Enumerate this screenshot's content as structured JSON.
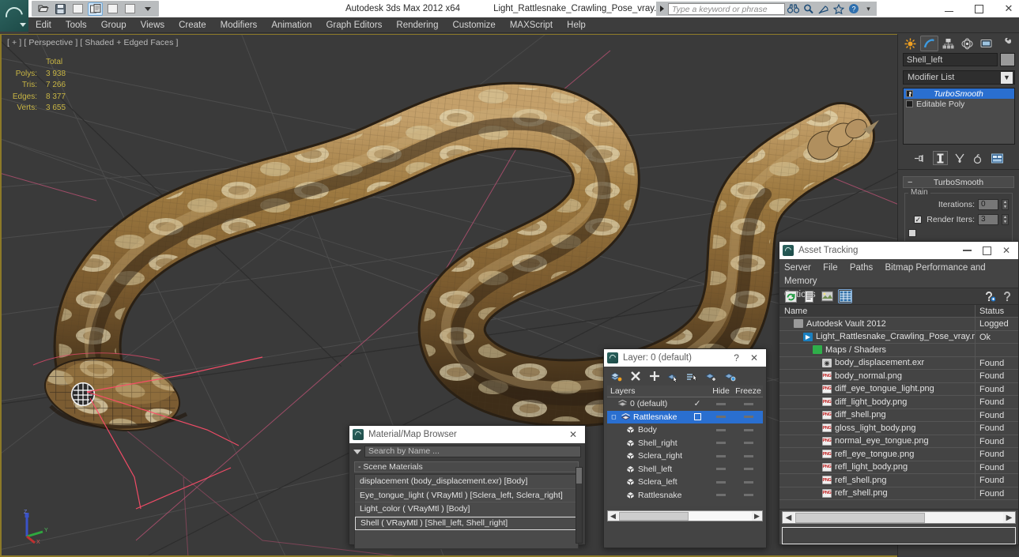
{
  "titlebar": {
    "app_title": "Autodesk 3ds Max  2012 x64",
    "file_title": "Light_Rattlesnake_Crawling_Pose_vray.max",
    "quick_access": [
      {
        "name": "open-file",
        "label": "open"
      },
      {
        "name": "save-file",
        "label": "save"
      },
      {
        "name": "undo",
        "label": "undo"
      },
      {
        "name": "redo",
        "label": "redo"
      },
      {
        "name": "blank-1",
        "label": ""
      },
      {
        "name": "blank-2",
        "label": ""
      }
    ],
    "search_placeholder": "Type a keyword or phrase",
    "help_icons": [
      "binoculars-icon",
      "magnifier-icon",
      "satellite-icon",
      "star-icon",
      "help-icon"
    ],
    "window_controls": [
      "minimize",
      "maximize",
      "close"
    ]
  },
  "menu": {
    "items": [
      "Edit",
      "Tools",
      "Group",
      "Views",
      "Create",
      "Modifiers",
      "Animation",
      "Graph Editors",
      "Rendering",
      "Customize",
      "MAXScript",
      "Help"
    ]
  },
  "viewport": {
    "label": "[ + ] [ Perspective ] [ Shaded + Edged Faces ]",
    "stats": {
      "header": "Total",
      "rows": [
        {
          "label": "Polys:",
          "value": "3 938"
        },
        {
          "label": "Tris:",
          "value": "7 266"
        },
        {
          "label": "Edges:",
          "value": "8 377"
        },
        {
          "label": "Verts:",
          "value": "3 655"
        }
      ]
    },
    "axis": {
      "x": "X",
      "y": "Y",
      "z": "Z"
    },
    "colors": {
      "background": "#3a3a3a",
      "grid": "#565656",
      "border": "#8d7a28",
      "stats_text": "#c8b544",
      "snake_body": "#8a6a3a",
      "snake_light": "#e0d5b0",
      "snake_dark": "#4a3420",
      "selection": "#ff4d6a"
    }
  },
  "command_panel": {
    "tabs": [
      "create-tab",
      "modify-tab",
      "hierarchy-tab",
      "motion-tab",
      "display-tab",
      "utilities-tab"
    ],
    "selected_tab": "modify-tab",
    "object_name": "Shell_left",
    "modifier_list_label": "Modifier List",
    "stack": [
      {
        "label": "TurboSmooth",
        "selected": true
      },
      {
        "label": "Editable Poly",
        "selected": false
      }
    ],
    "stack_buttons": [
      "pin-stack-icon",
      "show-end-result-icon",
      "make-unique-icon",
      "remove-modifier-icon",
      "configure-sets-icon"
    ],
    "rollout": {
      "title": "TurboSmooth",
      "group_label": "Main",
      "params": [
        {
          "label": "Iterations:",
          "value": "0",
          "checkbox": false
        },
        {
          "label": "Render Iters:",
          "value": "3",
          "checkbox": true
        }
      ]
    }
  },
  "asset_tracking": {
    "title": "Asset Tracking",
    "menu": [
      "Server",
      "File",
      "Paths",
      "Bitmap Performance and Memory",
      "Options"
    ],
    "toolbar_icons": [
      "refresh-icon",
      "list-view-icon",
      "thumbnail-view-icon",
      "grid-view-icon",
      "add-help-icon",
      "help-icon"
    ],
    "columns": {
      "name": "Name",
      "status": "Status"
    },
    "rows": [
      {
        "name": "Autodesk Vault 2012",
        "status": "Logged",
        "indent": 0,
        "icon": "vault-icon"
      },
      {
        "name": "Light_Rattlesnake_Crawling_Pose_vray.max",
        "status": "Ok",
        "indent": 1,
        "icon": "max-file-icon"
      },
      {
        "name": "Maps / Shaders",
        "status": "",
        "indent": 2,
        "icon": "maps-icon"
      },
      {
        "name": "body_displacement.exr",
        "status": "Found",
        "indent": 3,
        "icon": "exr-icon"
      },
      {
        "name": "body_normal.png",
        "status": "Found",
        "indent": 3,
        "icon": "png-icon"
      },
      {
        "name": "diff_eye_tongue_light.png",
        "status": "Found",
        "indent": 3,
        "icon": "png-icon"
      },
      {
        "name": "diff_light_body.png",
        "status": "Found",
        "indent": 3,
        "icon": "png-icon"
      },
      {
        "name": "diff_shell.png",
        "status": "Found",
        "indent": 3,
        "icon": "png-icon"
      },
      {
        "name": "gloss_light_body.png",
        "status": "Found",
        "indent": 3,
        "icon": "png-icon"
      },
      {
        "name": "normal_eye_tongue.png",
        "status": "Found",
        "indent": 3,
        "icon": "png-icon"
      },
      {
        "name": "refl_eye_tongue.png",
        "status": "Found",
        "indent": 3,
        "icon": "png-icon"
      },
      {
        "name": "refl_light_body.png",
        "status": "Found",
        "indent": 3,
        "icon": "png-icon"
      },
      {
        "name": "refl_shell.png",
        "status": "Found",
        "indent": 3,
        "icon": "png-icon"
      },
      {
        "name": "refr_shell.png",
        "status": "Found",
        "indent": 3,
        "icon": "png-icon"
      }
    ]
  },
  "layer_dialog": {
    "title": "Layer: 0 (default)",
    "help_label": "?",
    "close_label": "✕",
    "toolbar_icons": [
      "create-new-layer-icon",
      "delete-layer-icon",
      "add-selection-icon",
      "select-objects-icon",
      "select-highlighted-icon",
      "highlight-selected-icon",
      "hide-unselected-icon"
    ],
    "columns": {
      "layers": "Layers",
      "hide": "Hide",
      "freeze": "Freeze"
    },
    "rows": [
      {
        "name": "0 (default)",
        "indent": 0,
        "selected": false,
        "mark": "check",
        "icon": "layer-icon"
      },
      {
        "name": "Rattlesnake",
        "indent": 0,
        "selected": true,
        "mark": "box",
        "icon": "layer-icon"
      },
      {
        "name": "Body",
        "indent": 1,
        "selected": false,
        "mark": "",
        "icon": "object-icon"
      },
      {
        "name": "Shell_right",
        "indent": 1,
        "selected": false,
        "mark": "",
        "icon": "object-icon"
      },
      {
        "name": "Sclera_right",
        "indent": 1,
        "selected": false,
        "mark": "",
        "icon": "object-icon"
      },
      {
        "name": "Shell_left",
        "indent": 1,
        "selected": false,
        "mark": "",
        "icon": "object-icon"
      },
      {
        "name": "Sclera_left",
        "indent": 1,
        "selected": false,
        "mark": "",
        "icon": "object-icon"
      },
      {
        "name": "Rattlesnake",
        "indent": 1,
        "selected": false,
        "mark": "",
        "icon": "object-icon"
      }
    ]
  },
  "material_browser": {
    "title": "Material/Map Browser",
    "close_label": "✕",
    "search_placeholder": "Search by Name ...",
    "group_label": "- Scene Materials",
    "items": [
      {
        "label": "displacement (body_displacement.exr) [Body]",
        "selected": false
      },
      {
        "label": "Eye_tongue_light  ( VRayMtl )  [Sclera_left, Sclera_right]",
        "selected": false
      },
      {
        "label": "Light_color  ( VRayMtl )  [Body]",
        "selected": false
      },
      {
        "label": "Shell  ( VRayMtl )  [Shell_left, Shell_right]",
        "selected": true
      }
    ]
  }
}
